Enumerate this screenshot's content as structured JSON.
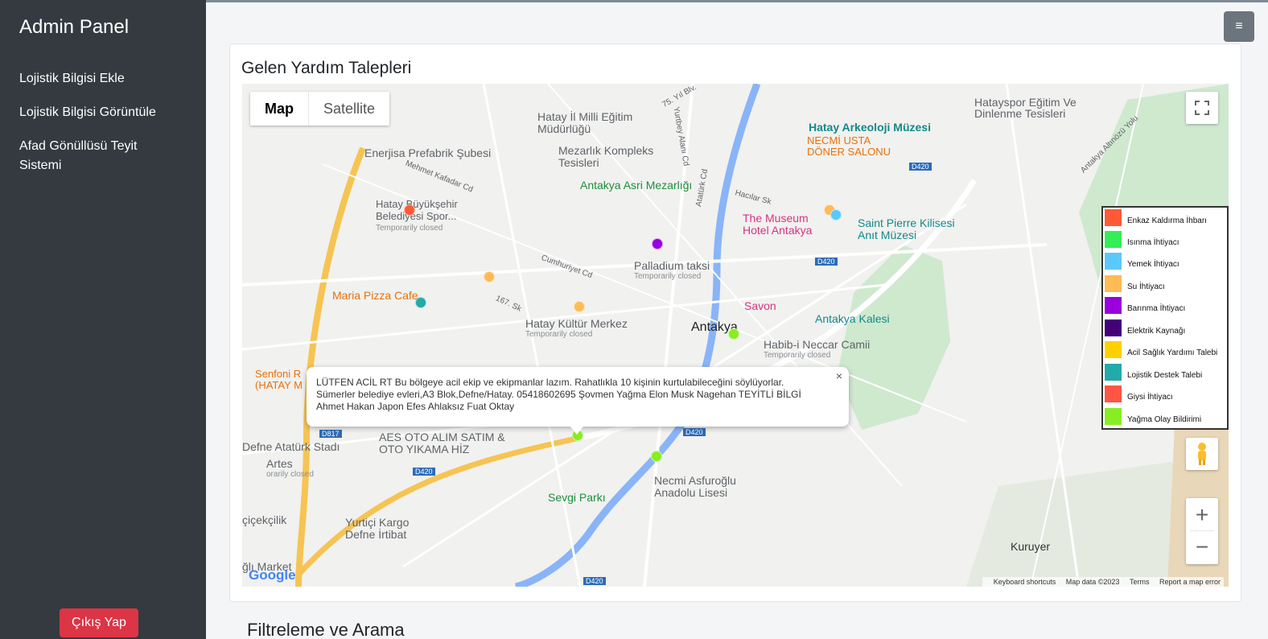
{
  "sidebar": {
    "title": "Admin Panel",
    "items": [
      {
        "label": "Lojistik Bilgisi Ekle"
      },
      {
        "label": "Lojistik Bilgisi Görüntüle"
      },
      {
        "label": "Afad Gönüllüsü Teyit Sistemi"
      }
    ],
    "logout_label": "Çıkış Yap"
  },
  "header": {
    "toggle_icon": "menu-icon",
    "toggle_glyph": "≡"
  },
  "main": {
    "card_title": "Gelen Yardım Talepleri",
    "section_title": "Filtreleme ve Arama"
  },
  "map": {
    "type_buttons": [
      "Map",
      "Satellite"
    ],
    "active_type": "Map",
    "zoom_in": "+",
    "zoom_out": "−",
    "legend": [
      {
        "label": "Enkaz Kaldırma İhbarı",
        "color": "#ff5a36"
      },
      {
        "label": "Isınma İhtiyacı",
        "color": "#33ee55"
      },
      {
        "label": "Yemek İhtiyacı",
        "color": "#5bc8fb"
      },
      {
        "label": "Su İhtiyacı",
        "color": "#ffbb55"
      },
      {
        "label": "Barınma İhtiyacı",
        "color": "#9900dd"
      },
      {
        "label": "Elektrik Kaynağı",
        "color": "#440077"
      },
      {
        "label": "Acil Sağlık Yardımı Talebi",
        "color": "#ffd000"
      },
      {
        "label": "Lojistik Destek Talebi",
        "color": "#22aaaa"
      },
      {
        "label": "Giysi İhtiyacı",
        "color": "#ff5544"
      },
      {
        "label": "Yağma Olay Bildirimi",
        "color": "#88ee22"
      }
    ],
    "infowindow": {
      "text": "LÜTFEN ACİL RT Bu bölgeye acil ekip ve ekipmanlar lazım. Rahatlıkla 10 kişinin kurtulabileceğini söylüyorlar. Sümerler belediye evleri,A3 Blok,Defne/Hatay. 05418602695 Şovmen Yağma Elon Musk Nagehan TEYİTLİ BİLGİ Ahmet Hakan Japon Efes Ahlaksız Fuat Oktay",
      "close": "×"
    },
    "labels": {
      "hatayspor": "Hatayspor Eğitim Ve Dinlenme Tesisleri",
      "arkeoloji": "Hatay Arkeoloji Müzesi",
      "necmi": "NECMİ USTA DÖNER SALONU",
      "milli": "Hatay İl Milli Eğitim Müdürlüğü",
      "mezarlik": "Mezarlık Kompleks Tesisleri",
      "enerjisa": "Enerjisa Prefabrik Şubesi",
      "asri": "Antakya Asri Mezarlığı",
      "buyuksehir": "Hatay Büyükşehir Belediyesi Spor...",
      "temp1": "Temporarily closed",
      "museum": "The Museum Hotel Antakya",
      "saint": "Saint Pierre Kilisesi Anıt Müzesi",
      "palladium": "Palladium taksi",
      "temp2": "Temporarily closed",
      "maria": "Maria Pizza Cafe",
      "savon": "Savon",
      "kultur": "Hatay Kültür Merkez",
      "temp3": "Temporarily closed",
      "antakya": "Antakya",
      "kalesi": "Antakya Kalesi",
      "habib": "Habib-i Neccar Camii",
      "temp4": "Temporarily closed",
      "senfoni": "Senfoni R (HATAY M",
      "aes": "AES OTO ALIM SATIM & OTO YIKAMA HİZ",
      "defne": "Defne Atatürk Stadı",
      "artes": "Artes",
      "temp5": "orarily closed",
      "necmi_lise": "Necmi Asfuroğlu Anadolu Lisesi",
      "sevgi": "Sevgi Parkı",
      "cicekcilik": "çiçekçilik",
      "yurtici": "Yurtiçi Kargo Defne İrtibat",
      "market": "ğlı Market",
      "kuruyer": "Kuruyer",
      "road_d420": "D420",
      "road_d817": "D817",
      "street1": "Cumhuriyet Cd",
      "street2": "Mehmet Kafadar Cd",
      "street3": "Hacılar Sk",
      "street4": "167. Sk",
      "street5": "75. Yıl Blv.",
      "street6": "Yurtbey Alanı Cd",
      "street7": "Atatürk Cd",
      "street8": "Antakya Altınözü Yolu"
    },
    "attribution": {
      "google": "Google",
      "shortcuts": "Keyboard shortcuts",
      "mapdata": "Map data ©2023",
      "terms": "Terms",
      "report": "Report a map error"
    }
  }
}
